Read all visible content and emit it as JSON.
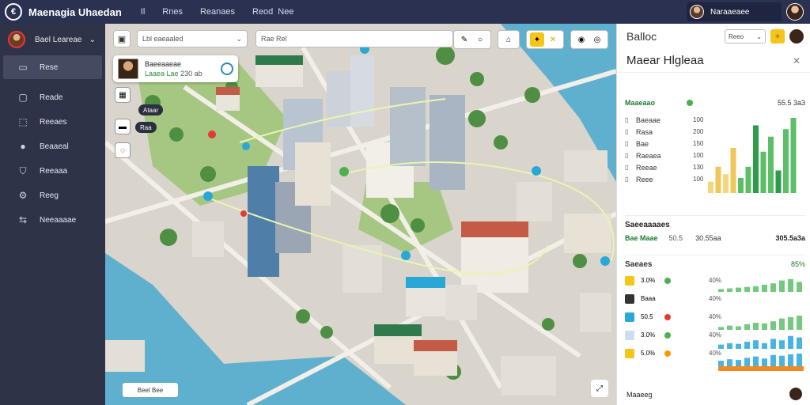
{
  "topbar": {
    "app_title": "Maenagia Uhaedan",
    "nav": [
      "Il",
      "Rnes",
      "Reanaes",
      "Reod",
      "Nee"
    ],
    "user_name": "Naraaeaee"
  },
  "sidebar": {
    "user_name": "Bael Leareae",
    "items": [
      {
        "label": "Rese",
        "icon": "monitor-icon"
      },
      {
        "label": "Reade",
        "icon": "document-icon"
      },
      {
        "label": "Reeaes",
        "icon": "map-icon"
      },
      {
        "label": "Beaaeal",
        "icon": "user-icon"
      },
      {
        "label": "Reeaaa",
        "icon": "shield-icon"
      },
      {
        "label": "Reeg",
        "icon": "gear-icon"
      },
      {
        "label": "Neeaaaae",
        "icon": "share-icon"
      }
    ]
  },
  "map": {
    "select_value": "Lbl eaeaaled",
    "search_value": "Rae Rel",
    "card_title": "Baeeaaeae",
    "card_sub": "Laaea Lae",
    "card_sub2": "230 ab",
    "tag1": "Ataar",
    "tag2": "Raa",
    "footer": "Beel Bee",
    "colors": {
      "water": "#5fb0cf",
      "park": "#a5c781",
      "road": "#d9d4cc",
      "tree": "#4f8f43"
    }
  },
  "panel": {
    "header": "Balloc",
    "select_value": "Reeo",
    "title": "Maear Hlgleaa",
    "section1": {
      "title": "Maaeaao",
      "value": "55.5 3a3"
    },
    "metrics": [
      {
        "label": "Baeaae",
        "num": "100",
        "icon": "list-icon"
      },
      {
        "label": "Rasa",
        "num": "200",
        "icon": "list-icon"
      },
      {
        "label": "Bae",
        "num": "150",
        "icon": "list-icon"
      },
      {
        "label": "Raeaea",
        "num": "100",
        "icon": "list-icon"
      },
      {
        "label": "Reeae",
        "num": "130",
        "icon": "list-icon"
      },
      {
        "label": "Reee",
        "num": "100",
        "icon": "list-icon"
      }
    ],
    "bars": [
      0.15,
      0.35,
      0.25,
      0.6,
      0.2,
      0.35,
      0.9,
      0.55,
      0.75,
      0.3,
      0.85,
      1.0
    ],
    "bar_ticks": [
      "aa",
      "aa",
      "aa",
      "aa",
      "aa"
    ],
    "summary": {
      "title": "Saeeaaaaes",
      "k": "Bae Maae",
      "v": "50.5",
      "v2": "30.55aa",
      "v3": "305.5a3a"
    },
    "settings_title": "Saeaes",
    "settings_val": "85%",
    "settings": [
      {
        "a": "3.0%",
        "c": "40%",
        "color": "#f5c518",
        "dot": "#4caf50"
      },
      {
        "a": "Baaa",
        "c": "40%",
        "color": "#333",
        "dot": ""
      },
      {
        "a": "50.5",
        "c": "40%",
        "color": "#29a8d8",
        "dot": "#e53935"
      },
      {
        "a": "3.0%",
        "c": "40%",
        "color": "#cde",
        "dot": "#4caf50"
      },
      {
        "a": "5.0%",
        "c": "40%",
        "color": "#f5c518",
        "dot": "#ff9800"
      }
    ],
    "footer": "Maaeeg"
  }
}
